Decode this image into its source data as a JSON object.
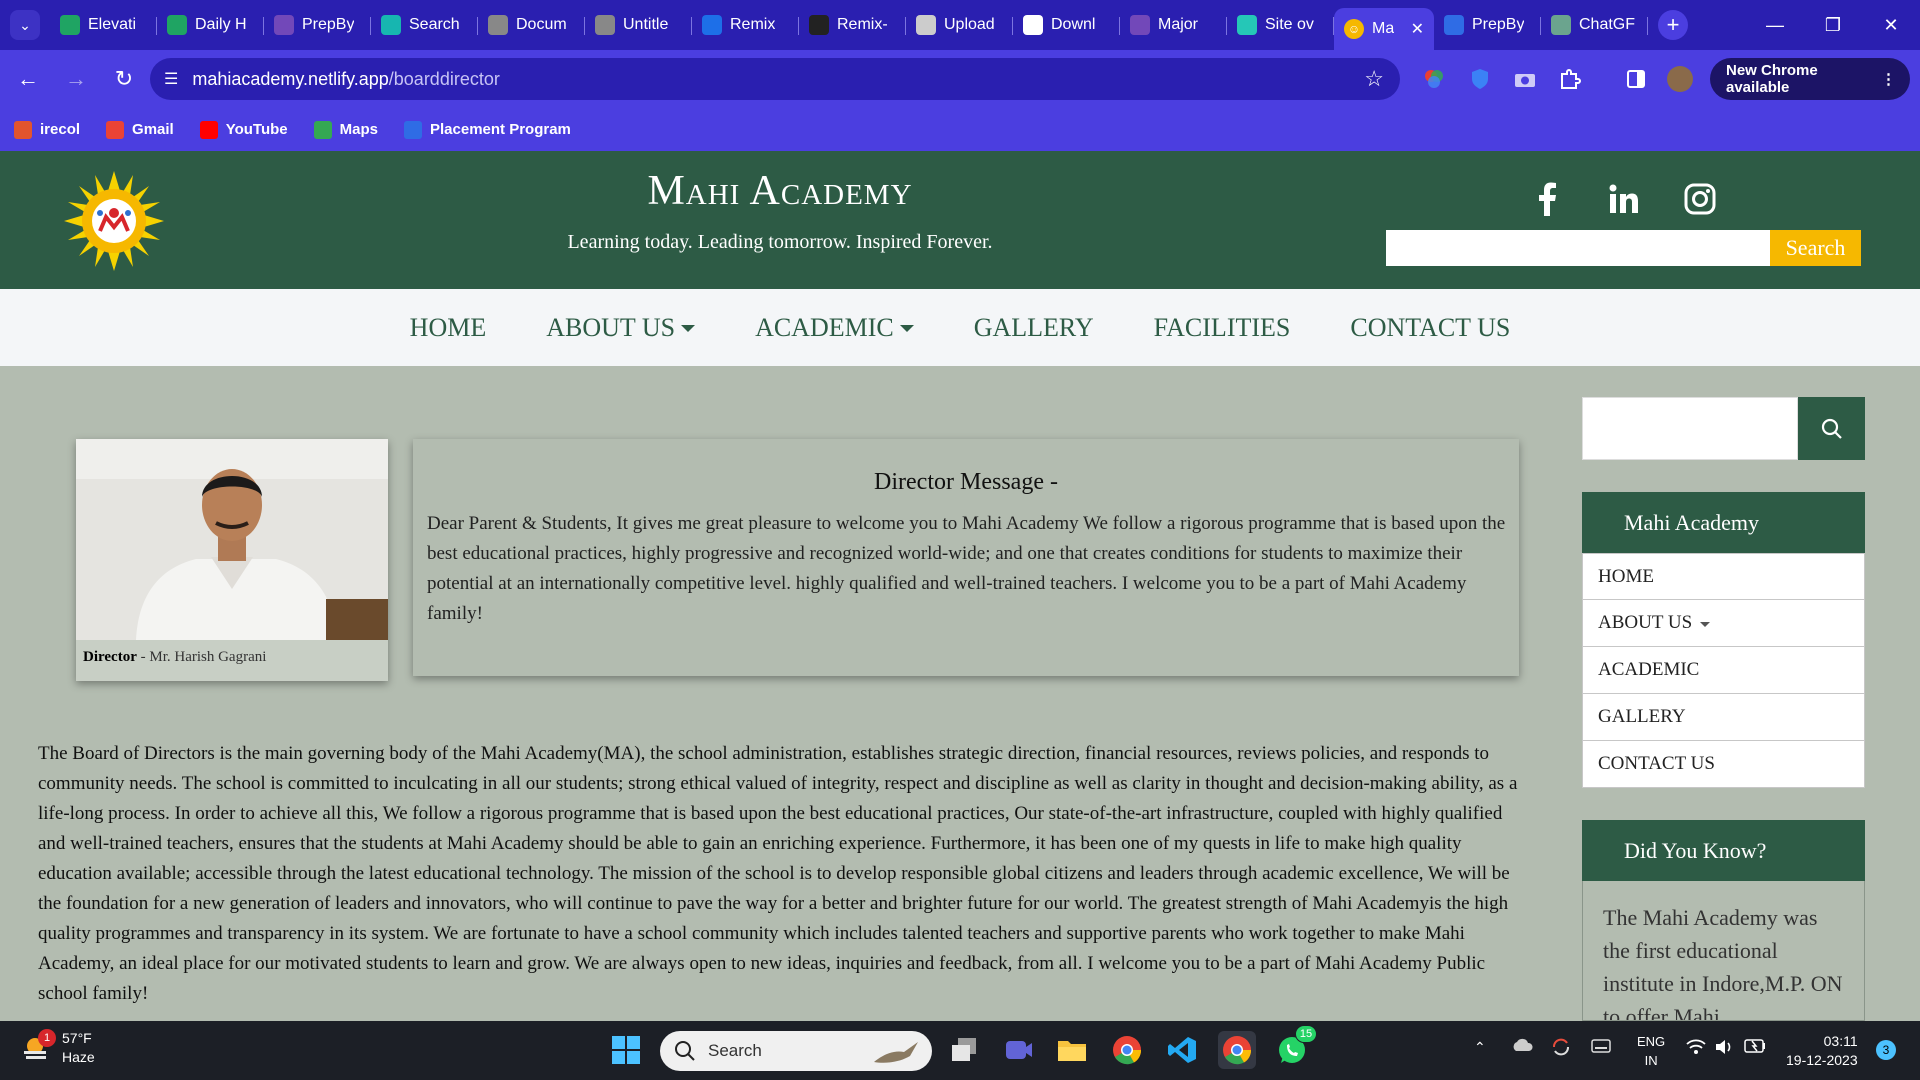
{
  "browser": {
    "tabs": [
      {
        "label": "Elevati",
        "icon": "sheets-icon",
        "color": "#1fa463"
      },
      {
        "label": "Daily H",
        "icon": "sheets-icon",
        "color": "#1fa463"
      },
      {
        "label": "PrepBy",
        "icon": "forms-icon",
        "color": "#7248b9"
      },
      {
        "label": "Search",
        "icon": "v-logo-icon",
        "color": "#17b6b0"
      },
      {
        "label": "Docum",
        "icon": "globe-icon",
        "color": "#888888"
      },
      {
        "label": "Untitle",
        "icon": "globe-icon",
        "color": "#888888"
      },
      {
        "label": "Remix",
        "icon": "remix-icon",
        "color": "#1d6fe8"
      },
      {
        "label": "Remix-",
        "icon": "github-icon",
        "color": "#222222"
      },
      {
        "label": "Upload",
        "icon": "layers-icon",
        "color": "#cccccc"
      },
      {
        "label": "Downl",
        "icon": "download-icon",
        "color": "#ffffff"
      },
      {
        "label": "Major",
        "icon": "forms-icon",
        "color": "#7248b9"
      },
      {
        "label": "Site ov",
        "icon": "netlify-icon",
        "color": "#25c7b7"
      }
    ],
    "active_tab": {
      "label": "Ma",
      "icon": "mahi-favicon"
    },
    "tabs_after": [
      {
        "label": "PrepBy",
        "icon": "prepbytes-icon",
        "color": "#2f6ce5"
      },
      {
        "label": "ChatGF",
        "icon": "chatgpt-icon",
        "color": "#6ba48e"
      }
    ],
    "url_host": "mahiacademy.netlify.app",
    "url_path": "/boarddirector",
    "new_chrome_label": "New Chrome available",
    "bookmarks": [
      {
        "label": "irecol",
        "icon": "irecol-icon",
        "color": "#e2542d"
      },
      {
        "label": "Gmail",
        "icon": "gmail-icon",
        "color": "#ea4335"
      },
      {
        "label": "YouTube",
        "icon": "youtube-icon",
        "color": "#ff0000"
      },
      {
        "label": "Maps",
        "icon": "maps-icon",
        "color": "#34a853"
      },
      {
        "label": "Placement Program",
        "icon": "prepbytes-icon",
        "color": "#2f6ce5"
      }
    ]
  },
  "site": {
    "brand": "Mahi Academy",
    "tagline": "Learning today. Leading tomorrow. Inspired Forever.",
    "search_button": "Search",
    "nav": [
      {
        "label": "HOME",
        "dropdown": false
      },
      {
        "label": "ABOUT US",
        "dropdown": true
      },
      {
        "label": "ACADEMIC",
        "dropdown": true
      },
      {
        "label": "GALLERY",
        "dropdown": false
      },
      {
        "label": "FACILITIES",
        "dropdown": false
      },
      {
        "label": "CONTACT US",
        "dropdown": false
      }
    ],
    "director": {
      "role": "Director",
      "name": " - Mr. Harish Gagrani"
    },
    "message": {
      "title": "Director Message -",
      "body": "Dear Parent & Students, It gives me great pleasure to welcome you to Mahi Academy We follow a rigorous programme that is based upon the best educational practices, highly progressive and recognized world-wide; and one that creates conditions for students to maximize their potential at an internationally competitive level. highly qualified and well-trained teachers. I welcome you to be a part of Mahi Academy family!"
    },
    "board_text": "The Board of Directors is the main governing body of the Mahi Academy(MA), the school administration, establishes strategic direction, financial resources, reviews policies, and responds to community needs. The school is committed to inculcating in all our students; strong ethical valued of integrity, respect and discipline as well as clarity in thought and decision-making ability, as a life-long process. In order to achieve all this, We follow a rigorous programme that is based upon the best educational practices, Our state-of-the-art infrastructure, coupled with highly qualified and well-trained teachers, ensures that the students at Mahi Academy should be able to gain an enriching experience. Furthermore, it has been one of my quests in life to make high quality education available; accessible through the latest educational technology. The mission of the school is to develop responsible global citizens and leaders through academic excellence, We will be the foundation for a new generation of leaders and innovators, who will continue to pave the way for a better and brighter future for our world. The greatest strength of Mahi Academyis the high quality programmes and transparency in its system. We are fortunate to have a school community which includes talented teachers and supportive parents who work together to make Mahi Academy, an ideal place for our motivated students to learn and grow. We are always open to new ideas, inquiries and feedback, from all. I welcome you to be a part of Mahi Academy Public school family!",
    "sidebar": {
      "title": "Mahi Academy",
      "items": [
        {
          "label": "HOME",
          "dropdown": false
        },
        {
          "label": "ABOUT US",
          "dropdown": true
        },
        {
          "label": "ACADEMIC",
          "dropdown": false
        },
        {
          "label": "GALLERY",
          "dropdown": false
        },
        {
          "label": "CONTACT US",
          "dropdown": false
        }
      ],
      "did_you_know_title": "Did You Know?",
      "did_you_know_text": "The Mahi Academy was the first educational institute in Indore,M.P. ON to offer Mahi"
    },
    "colors": {
      "primary": "#2d5b45",
      "accent": "#f6b800",
      "page_bg": "#b3bcb0"
    }
  },
  "taskbar": {
    "weather_temp": "57°F",
    "weather_desc": "Haze",
    "weather_badge": "1",
    "search_placeholder": "Search",
    "whatsapp_badge": "15",
    "lang_top": "ENG",
    "lang_bottom": "IN",
    "time": "03:11",
    "date": "19-12-2023",
    "notif_count": "3"
  }
}
